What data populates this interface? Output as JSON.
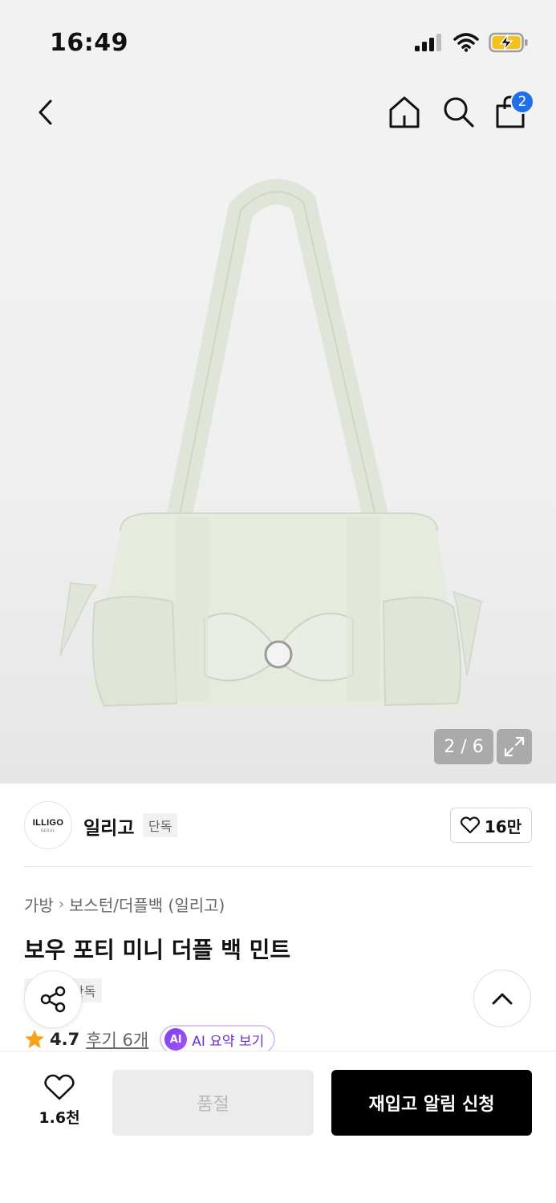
{
  "status_bar": {
    "time": "16:49",
    "icons": [
      "signal-icon",
      "wifi-icon",
      "battery-charging-icon"
    ]
  },
  "nav": {
    "cart_count": "2",
    "icons": [
      "back-icon",
      "home-icon",
      "search-icon",
      "cart-icon"
    ]
  },
  "gallery": {
    "counter": "2 / 6"
  },
  "brand": {
    "logo_text": "ILLIGO",
    "logo_subtext": "SEOUL",
    "name": "일리고",
    "tag": "단독",
    "likes": "16만"
  },
  "breadcrumb": {
    "category": "가방",
    "subcategory": "보스턴/더플백 (일리고)"
  },
  "product": {
    "title": "보우 포티 미니 더플 백 민트",
    "exclusive_tag": "단독"
  },
  "rating": {
    "value": "4.7",
    "reviews": "후기 6개",
    "ai_badge": "AI",
    "ai_label": "AI 요약 보기"
  },
  "bottom_bar": {
    "wish_count": "1.6천",
    "soldout_label": "품절",
    "restock_label": "재입고 알림 신청"
  },
  "colors": {
    "accent_blue": "#1e6fe8",
    "ai_purple": "#6b2fd6",
    "rating_star": "#f5a31a",
    "primary_button": "#000000"
  }
}
